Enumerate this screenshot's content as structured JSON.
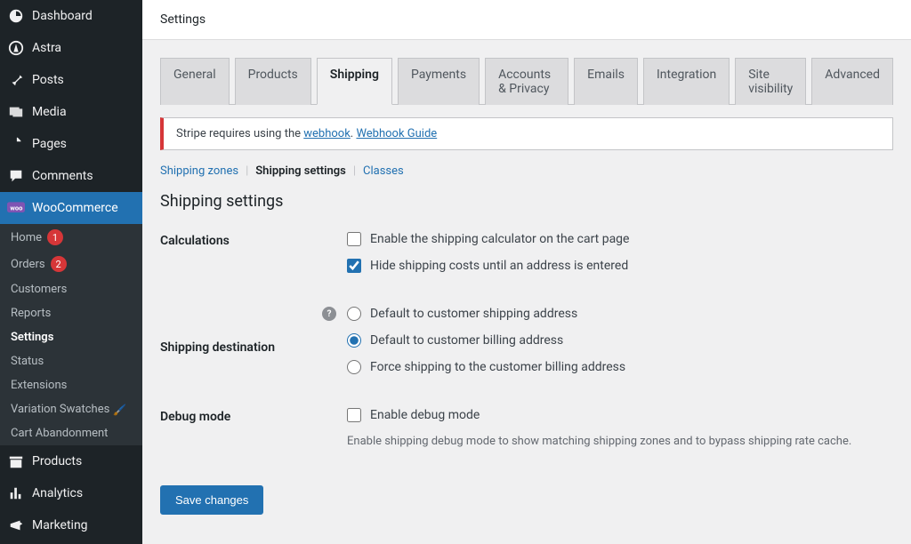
{
  "sidebar": {
    "items": [
      {
        "icon": "dashboard",
        "label": "Dashboard"
      },
      {
        "icon": "astra",
        "label": "Astra"
      },
      {
        "icon": "pin",
        "label": "Posts"
      },
      {
        "icon": "media",
        "label": "Media"
      },
      {
        "icon": "pages",
        "label": "Pages"
      },
      {
        "icon": "comments",
        "label": "Comments"
      }
    ],
    "active": {
      "icon": "woo",
      "label": "WooCommerce"
    },
    "sub": [
      {
        "label": "Home",
        "notif": "1"
      },
      {
        "label": "Orders",
        "notif": "2"
      },
      {
        "label": "Customers"
      },
      {
        "label": "Reports"
      },
      {
        "label": "Settings",
        "current": true
      },
      {
        "label": "Status"
      },
      {
        "label": "Extensions"
      },
      {
        "label": "Variation Swatches",
        "paint": true
      },
      {
        "label": "Cart Abandonment"
      }
    ],
    "after": [
      {
        "icon": "products",
        "label": "Products"
      },
      {
        "icon": "analytics",
        "label": "Analytics"
      },
      {
        "icon": "marketing",
        "label": "Marketing"
      }
    ]
  },
  "header": {
    "title": "Settings"
  },
  "tabs": [
    "General",
    "Products",
    "Shipping",
    "Payments",
    "Accounts & Privacy",
    "Emails",
    "Integration",
    "Site visibility",
    "Advanced"
  ],
  "active_tab": "Shipping",
  "notice": {
    "pre": "Stripe requires using the ",
    "link1": "webhook",
    "mid": ". ",
    "link2": "Webhook Guide"
  },
  "subnav": {
    "zones": "Shipping zones",
    "settings": "Shipping settings",
    "classes": "Classes"
  },
  "section_title": "Shipping settings",
  "form": {
    "calculations": {
      "label": "Calculations",
      "enable_calc": "Enable the shipping calculator on the cart page",
      "hide_costs": "Hide shipping costs until an address is entered"
    },
    "destination": {
      "label": "Shipping destination",
      "opt1": "Default to customer shipping address",
      "opt2": "Default to customer billing address",
      "opt3": "Force shipping to the customer billing address"
    },
    "debug": {
      "label": "Debug mode",
      "enable": "Enable debug mode",
      "desc": "Enable shipping debug mode to show matching shipping zones and to bypass shipping rate cache."
    }
  },
  "save": "Save changes"
}
